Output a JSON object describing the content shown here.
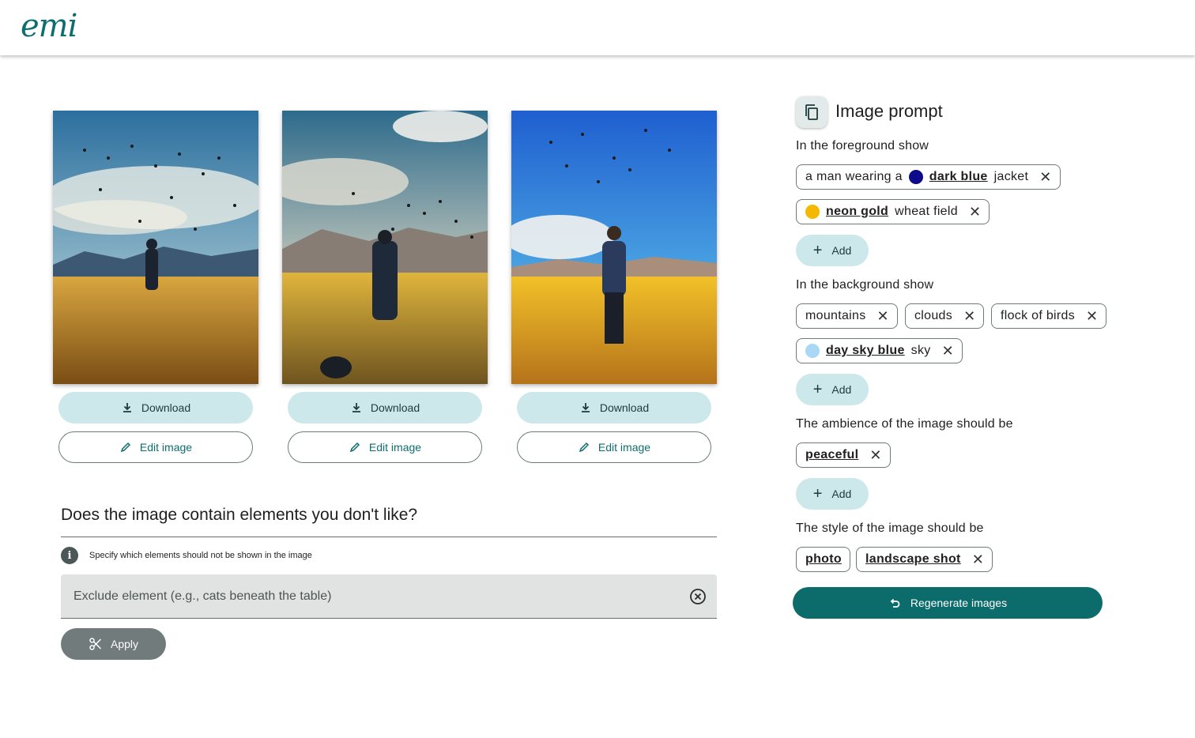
{
  "app": {
    "logo": "emi"
  },
  "gallery": {
    "images": [
      {
        "download_label": "Download",
        "edit_label": "Edit image"
      },
      {
        "download_label": "Download",
        "edit_label": "Edit image"
      },
      {
        "download_label": "Download",
        "edit_label": "Edit image"
      }
    ]
  },
  "exclude": {
    "title": "Does the image contain elements you don't like?",
    "hint": "Specify which elements should not be shown in the image",
    "placeholder": "Exclude element (e.g., cats beneath the table)",
    "apply_label": "Apply"
  },
  "prompt": {
    "title": "Image prompt",
    "foreground": {
      "label": "In the foreground show",
      "chips": [
        {
          "pre": "a man wearing a",
          "keyword": "dark blue",
          "post": "jacket",
          "color": "#0d0b8c"
        },
        {
          "pre": "",
          "keyword": "neon gold",
          "post": "wheat field",
          "color": "#f5b800"
        }
      ],
      "add_label": "Add"
    },
    "background": {
      "label": "In the background show",
      "chips": [
        {
          "text": "mountains"
        },
        {
          "text": "clouds"
        },
        {
          "text": "flock of birds"
        },
        {
          "keyword": "day sky blue",
          "post": "sky",
          "color": "#a8d8f5"
        }
      ],
      "add_label": "Add"
    },
    "ambience": {
      "label": "The ambience of the image should be",
      "chips": [
        {
          "keyword": "peaceful"
        }
      ],
      "add_label": "Add"
    },
    "style": {
      "label": "The style of the image should be",
      "chips": [
        {
          "keyword": "photo"
        },
        {
          "keyword": "landscape shot"
        }
      ]
    },
    "regenerate_label": "Regenerate images"
  },
  "colors": {
    "accent": "#0c6b6b",
    "tonal": "#cde8ea"
  }
}
